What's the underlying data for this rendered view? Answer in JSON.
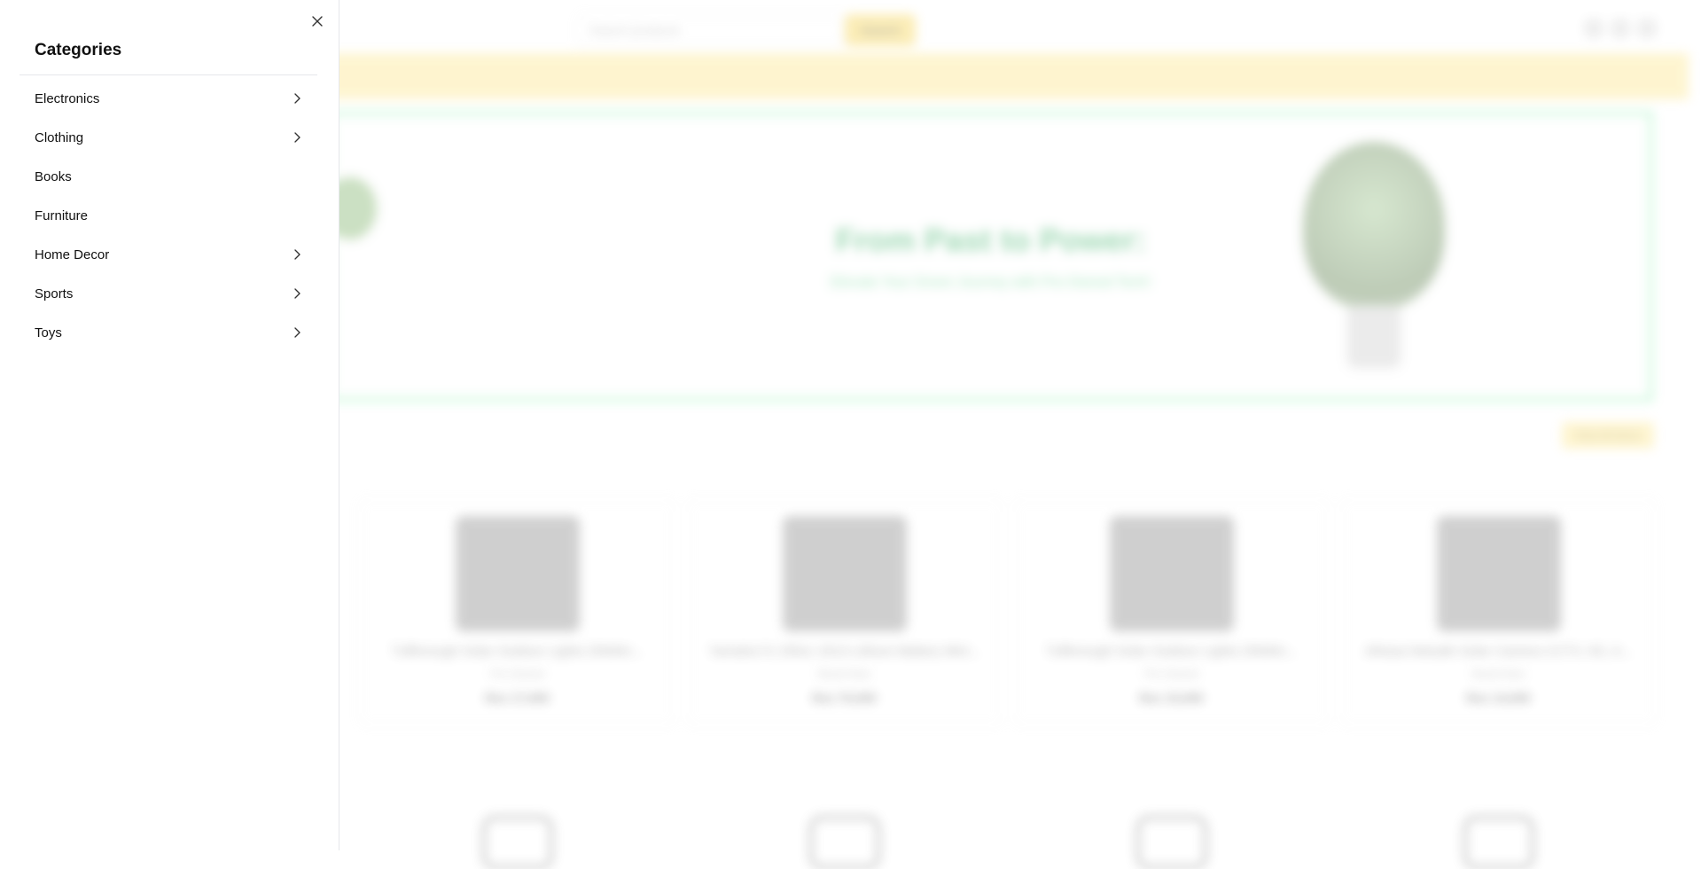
{
  "background": {
    "search": {
      "placeholder": "Search products",
      "button_label": "Search"
    },
    "hero": {
      "title": "From Past to Power:",
      "subtitle": "Elevate Your Green Journey with Pre-Owned Tech!"
    },
    "view_all_label": "View All Items",
    "products": [
      {
        "title": "Tuffenough Solar Outdoor Lights 2500lm...",
        "condition": "Pre-Owned",
        "price": "Rsx 17,000"
      },
      {
        "title": "Yamaha Fz 250cc 2013 Lithium Battery Mini...",
        "condition": "Brand New",
        "price": "Rsx 70,000"
      },
      {
        "title": "Tuffenough Solar Outdoor Lights 2500lm...",
        "condition": "Pre-Owned",
        "price": "Rsx 15,000"
      },
      {
        "title": "Athasa Netsafe Solar Camera CCTV, 4G, A...",
        "condition": "Brand New",
        "price": "Rsx 14,000"
      }
    ]
  },
  "drawer": {
    "title": "Categories",
    "close_icon": "close-icon",
    "categories": [
      {
        "label": "Electronics",
        "has_children": true
      },
      {
        "label": "Clothing",
        "has_children": true
      },
      {
        "label": "Books",
        "has_children": false
      },
      {
        "label": "Furniture",
        "has_children": false
      },
      {
        "label": "Home Decor",
        "has_children": true
      },
      {
        "label": "Sports",
        "has_children": true
      },
      {
        "label": "Toys",
        "has_children": true
      }
    ]
  },
  "colors": {
    "accent_yellow": "#fde68a",
    "accent_green": "#22c55e",
    "drawer_bg": "#ffffff",
    "text": "#111111"
  }
}
